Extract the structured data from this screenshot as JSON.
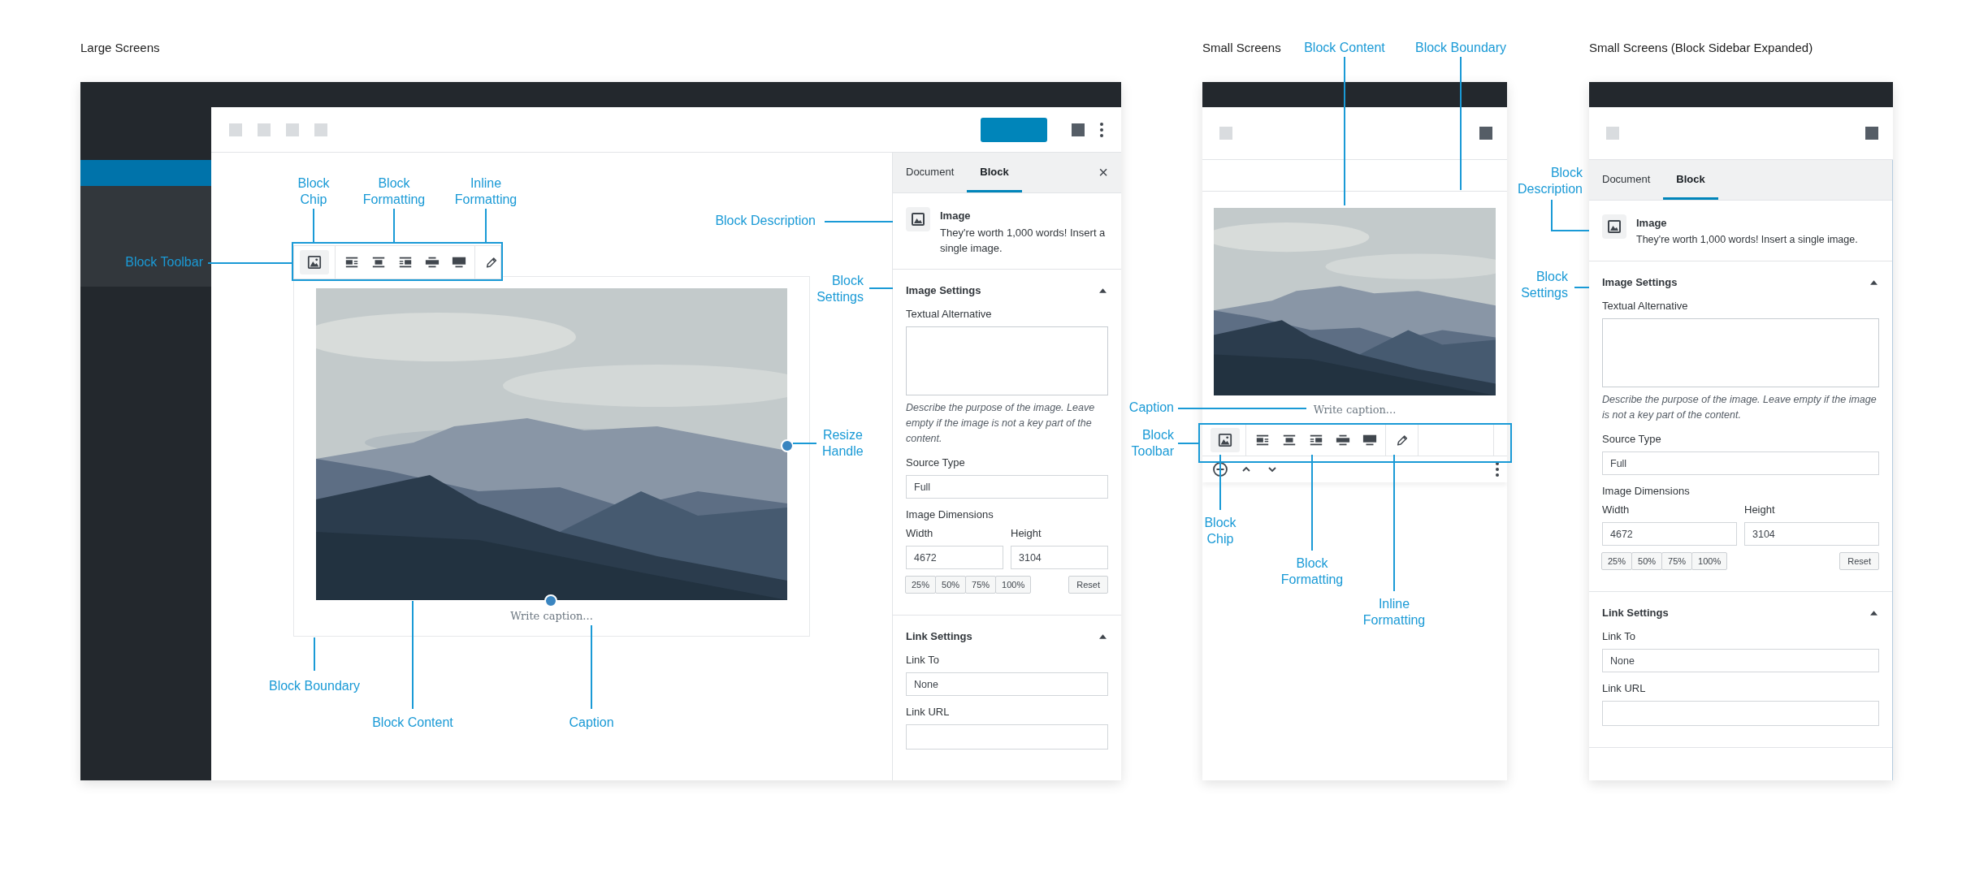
{
  "large_screens": {
    "heading": "Large Screens",
    "caption_placeholder": "Write caption...",
    "sidebar": {
      "tabs": [
        {
          "label": "Document",
          "selected": false
        },
        {
          "label": "Block",
          "selected": true
        }
      ],
      "close": "×",
      "block_card": {
        "title": "Image",
        "description": "They're worth 1,000 words! Insert a single image."
      },
      "image_settings": {
        "title": "Image Settings",
        "expanded": true,
        "alt_label": "Textual Alternative",
        "alt_help": "Describe the purpose of the image. Leave empty if the image is not a key part of the content.",
        "source_label": "Source Type",
        "source_value": "Full",
        "dimensions_label": "Image Dimensions",
        "width_label": "Width",
        "width_value": "4672",
        "height_label": "Height",
        "height_value": "3104",
        "presets": [
          "25%",
          "50%",
          "75%",
          "100%"
        ],
        "reset": "Reset"
      },
      "link_settings": {
        "title": "Link Settings",
        "expanded": true,
        "link_to_label": "Link To",
        "link_to_value": "None",
        "url_label": "Link URL"
      }
    },
    "annotations": [
      "Block Chip",
      "Block Formatting",
      "Inline Formatting",
      "Block Toolbar",
      "Block Description",
      "Block Settings",
      "Resize Handle",
      "Block Boundary",
      "Block Content",
      "Caption"
    ]
  },
  "small_screens": {
    "heading": "Small Screens",
    "caption_placeholder": "Write caption...",
    "annotations": [
      "Block Content",
      "Block Boundary",
      "Caption",
      "Block Toolbar",
      "Block Chip",
      "Block Formatting",
      "Inline Formatting"
    ]
  },
  "expanded_screens": {
    "heading": "Small Screens (Block Sidebar Expanded)",
    "sidebar": {
      "tabs": [
        {
          "label": "Document",
          "selected": false
        },
        {
          "label": "Block",
          "selected": true
        }
      ],
      "block_card": {
        "title": "Image",
        "description": "They're worth 1,000 words! Insert a single image."
      },
      "image_settings": {
        "title": "Image Settings",
        "expanded": true,
        "alt_label": "Textual Alternative",
        "alt_help": "Describe the purpose of the image. Leave empty if the image is not a key part of the content.",
        "source_label": "Source Type",
        "source_value": "Full",
        "dimensions_label": "Image Dimensions",
        "width_label": "Width",
        "width_value": "4672",
        "height_label": "Height",
        "height_value": "3104",
        "presets": [
          "25%",
          "50%",
          "75%",
          "100%"
        ],
        "reset": "Reset"
      },
      "link_settings": {
        "title": "Link Settings",
        "expanded": true,
        "link_to_label": "Link To",
        "link_to_value": "None",
        "url_label": "Link URL"
      }
    },
    "annotations": [
      "Block Description",
      "Block Settings"
    ]
  }
}
